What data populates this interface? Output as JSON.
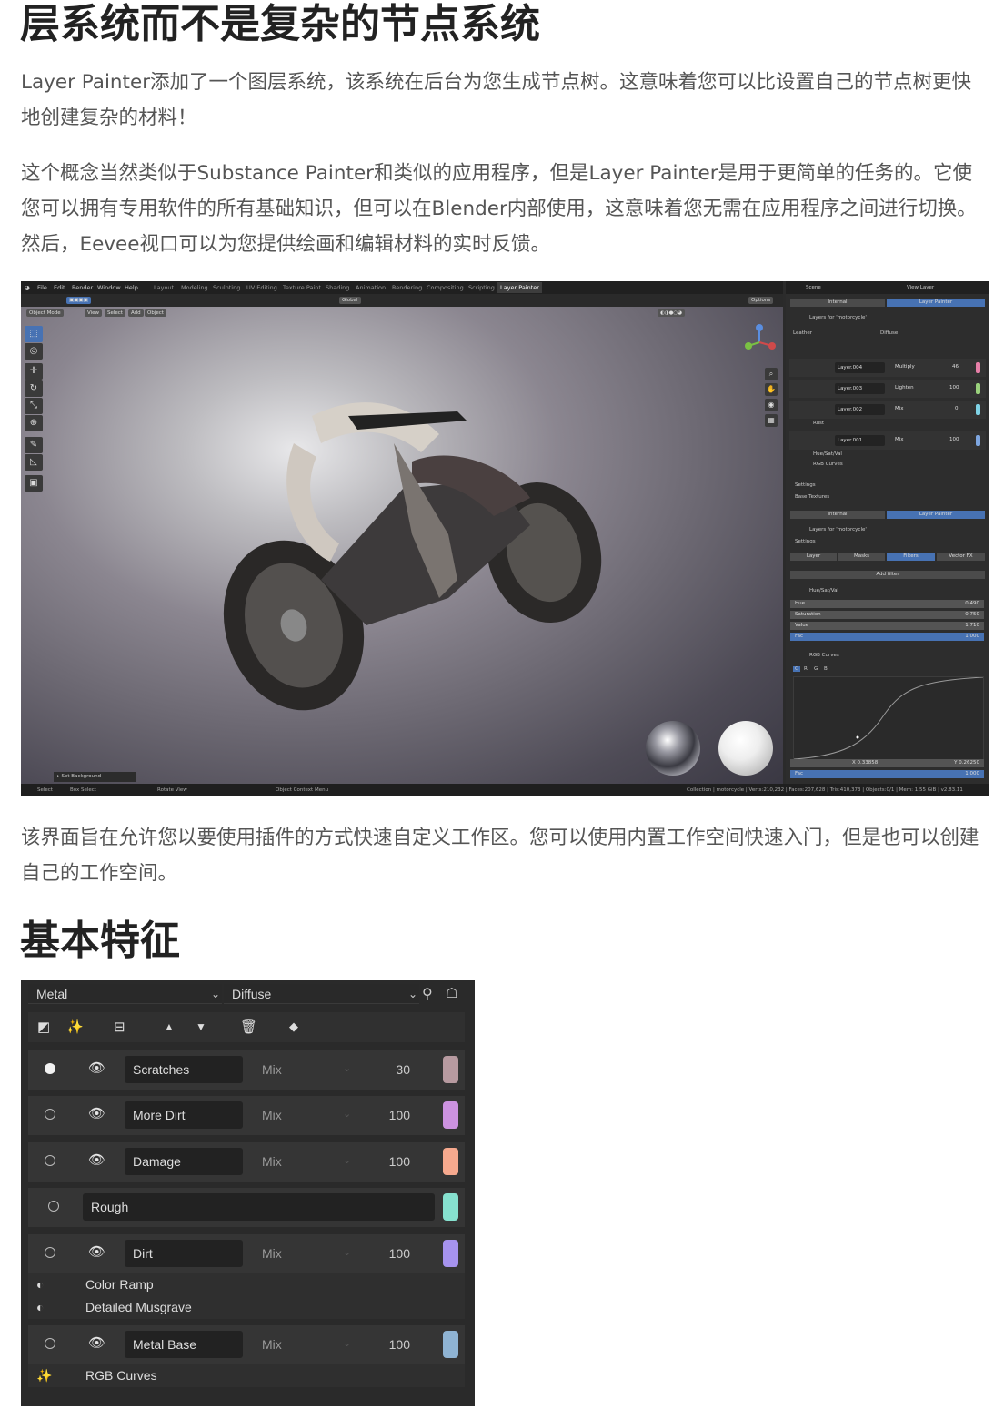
{
  "article": {
    "heading1": "层系统而不是复杂的节点系统",
    "para1": "Layer Painter添加了一个图层系统，该系统在后台为您生成节点树。这意味着您可以比设置自己的节点树更快地创建复杂的材料！",
    "para2": "这个概念当然类似于Substance Painter和类似的应用程序，但是Layer Painter是用于更简单的任务的。它使您可以拥有专用软件的所有基础知识，但可以在Blender内部使用，这意味着您无需在应用程序之间进行切换。然后，Eevee视口可以为您提供绘画和编辑材料的实时反馈。",
    "para3": "该界面旨在允许您以要使用插件的方式快速自定义工作区。您可以使用内置工作空间快速入门，但是也可以创建自己的工作空间。",
    "heading2": "基本特征"
  },
  "blender": {
    "menu": [
      "File",
      "Edit",
      "Render",
      "Window",
      "Help"
    ],
    "workspaces": [
      "Layout",
      "Modeling",
      "Sculpting",
      "UV Editing",
      "Texture Paint",
      "Shading",
      "Animation",
      "Rendering",
      "Compositing",
      "Scripting",
      "Layer Painter"
    ],
    "active_workspace": "Layer Painter",
    "scene": "Scene",
    "view_layer": "View Layer",
    "orientation": "Global",
    "options": "Options",
    "mode": "Object Mode",
    "header_menus": [
      "View",
      "Select",
      "Add",
      "Object"
    ],
    "set_background": "Set Background",
    "status_left": [
      "Select",
      "Box Select",
      "Rotate View",
      "Object Context Menu"
    ],
    "status_right": "Collection | motorcycle | Verts:210,232 | Faces:207,628 | Tris:410,373 | Objects:0/1 | Mem: 1.55 GiB | v2.83.11",
    "panel_tabs": [
      "Internal",
      "Layer Painter"
    ],
    "layers_for": "Layers for 'motorcycle'",
    "material": "Leather",
    "channel": "Diffuse",
    "layers": [
      {
        "name": "Layer.004",
        "blend": "Multiply",
        "value": "46",
        "color": "#e77fa8"
      },
      {
        "name": "Layer.003",
        "blend": "Lighten",
        "value": "100",
        "color": "#9ad17c"
      },
      {
        "name": "Layer.002",
        "blend": "Mix",
        "value": "0",
        "color": "#7fd3e6"
      },
      {
        "name": "Layer.001",
        "blend": "Mix",
        "value": "100",
        "color": "#7ea6e0"
      }
    ],
    "rust": "Rust",
    "filters_small": [
      "Hue/Sat/Val",
      "RGB Curves"
    ],
    "settings": "Settings",
    "base_textures": "Base Textures",
    "sub_tabs": [
      "Layer",
      "Masks",
      "Filters",
      "Vector FX"
    ],
    "add_filter": "Add filter",
    "hsv_title": "Hue/Sat/Val",
    "hsv": [
      {
        "label": "Hue",
        "value": "0.490"
      },
      {
        "label": "Saturation",
        "value": "0.750"
      },
      {
        "label": "Value",
        "value": "1.710"
      },
      {
        "label": "Fac",
        "value": "1.000"
      }
    ],
    "curves_title": "RGB Curves",
    "curve_channels": [
      "C",
      "R",
      "G",
      "B"
    ],
    "curve_x": "X 0.33858",
    "curve_y": "Y 0.26250",
    "curve_fac": "Fac",
    "curve_fac_value": "1.000"
  },
  "panel": {
    "material": "Metal",
    "channel": "Diffuse",
    "layers": [
      {
        "name": "Scratches",
        "blend": "Mix",
        "value": "30",
        "color": "#b79aa0",
        "active": true
      },
      {
        "name": "More Dirt",
        "blend": "Mix",
        "value": "100",
        "color": "#cc92e0",
        "active": false
      },
      {
        "name": "Damage",
        "blend": "Mix",
        "value": "100",
        "color": "#f6a98e",
        "active": false
      }
    ],
    "rough": {
      "name": "Rough",
      "color": "#86e1cf"
    },
    "dirt": {
      "name": "Dirt",
      "blend": "Mix",
      "value": "100",
      "color": "#a693ee"
    },
    "dirt_children": [
      "Color Ramp",
      "Detailed Musgrave"
    ],
    "metal_base": {
      "name": "Metal Base",
      "blend": "Mix",
      "value": "100",
      "color": "#8fb3d3"
    },
    "metal_base_child": "RGB Curves"
  }
}
